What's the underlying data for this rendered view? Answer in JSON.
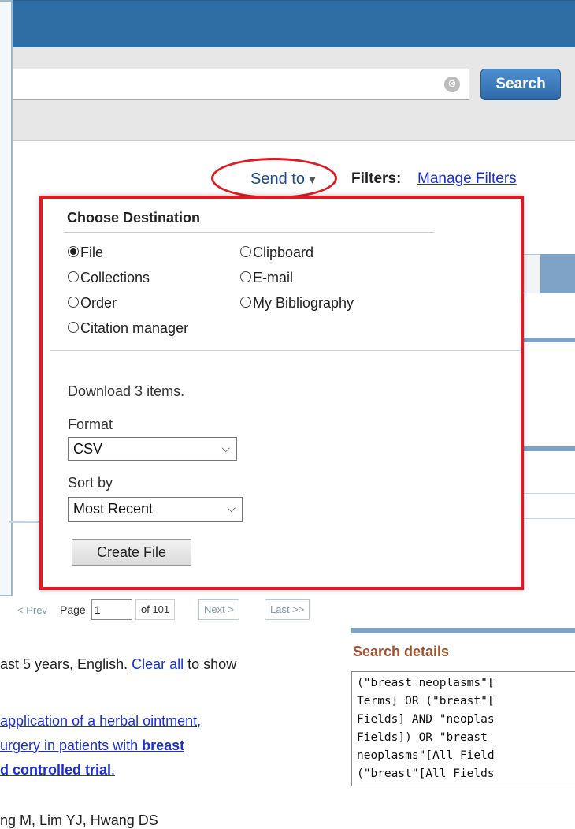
{
  "search": {
    "button_label": "Search",
    "clear_glyph": "⊗"
  },
  "toolbar": {
    "send_to_label": "Send to",
    "send_to_caret": "▾",
    "filters_label": "Filters:",
    "manage_filters_label": "Manage Filters"
  },
  "send_to_menu": {
    "heading": "Choose Destination",
    "options": [
      "File",
      "Clipboard",
      "Collections",
      "E-mail",
      "Order",
      "My Bibliography",
      "Citation manager"
    ],
    "selected": "File",
    "download_text": "Download 3 items.",
    "format_label": "Format",
    "format_value": "CSV",
    "sort_label": "Sort by",
    "sort_value": "Most Recent",
    "create_button": "Create File"
  },
  "pager": {
    "prev": "< Prev",
    "page_label": "Page",
    "page_value": "1",
    "of_label": "of 101",
    "next": "Next >",
    "last": "Last >>"
  },
  "results": {
    "filter_text_start": "ast 5 years, English.",
    "clear_all": "Clear all",
    "filter_text_end": "to show",
    "title_line1": "application of a herbal ointment,",
    "title_line2_pre": "urgery in patients with ",
    "title_line2_bold": "breast",
    "title_line3_bold": "d controlled trial",
    "title_line3_end": ".",
    "authors_partial": "ng M, Lim YJ, Hwang DS"
  },
  "search_details": {
    "heading": "Search details",
    "lines": [
      "(\"breast neoplasms\"[",
      "Terms] OR (\"breast\"[",
      "Fields] AND \"neoplas",
      "Fields]) OR \"breast ",
      "neoplasms\"[All Field",
      "(\"breast\"[All Fields"
    ]
  },
  "colors": {
    "header_blue": "#2f6ea4",
    "highlight_red": "#e01a22",
    "link_blue": "#1a2fd6"
  }
}
